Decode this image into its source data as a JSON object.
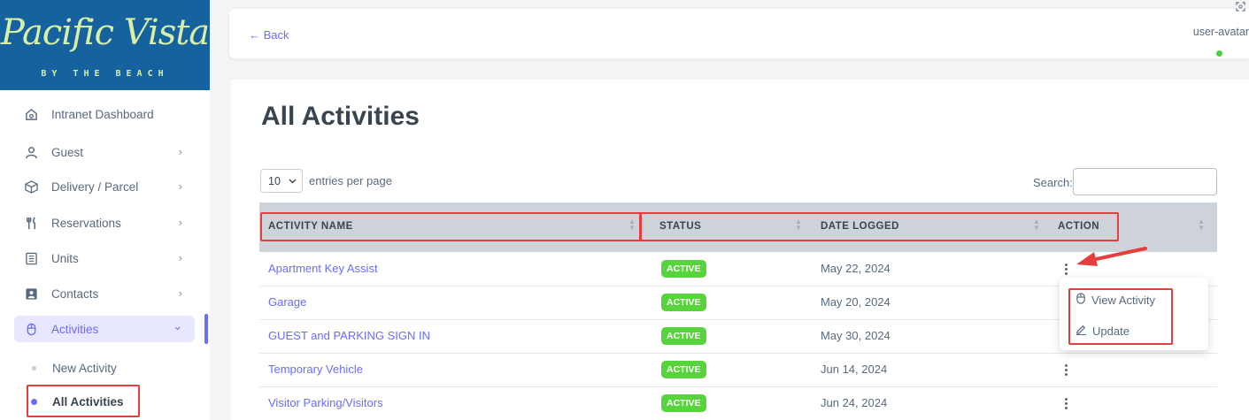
{
  "brand": {
    "name": "Pacific Vista",
    "tagline": "BY THE BEACH"
  },
  "sidebar": {
    "items": [
      {
        "label": "Intranet Dashboard",
        "icon": "home-icon",
        "has_chevron": false
      },
      {
        "label": "Guest",
        "icon": "user-icon",
        "has_chevron": true
      },
      {
        "label": "Delivery / Parcel",
        "icon": "package-icon",
        "has_chevron": true
      },
      {
        "label": "Reservations",
        "icon": "utensils-icon",
        "has_chevron": true
      },
      {
        "label": "Units",
        "icon": "list-icon",
        "has_chevron": true
      },
      {
        "label": "Contacts",
        "icon": "contact-card-icon",
        "has_chevron": true
      },
      {
        "label": "Activities",
        "icon": "mouse-icon",
        "has_chevron": true,
        "expanded": true,
        "active": true
      }
    ],
    "subitems": [
      {
        "label": "New Activity"
      },
      {
        "label": "All Activities",
        "current": true
      }
    ],
    "chevron_right": "›",
    "chevron_down": "⌄"
  },
  "topbar": {
    "back_label": "← Back",
    "avatar_alt": "user-avatar",
    "avatar_status_color": "#4ccf3d"
  },
  "main": {
    "title": "All Activities",
    "entries": {
      "value": "10",
      "label": "entries per page"
    },
    "search": {
      "label": "Search:",
      "value": ""
    },
    "columns": [
      "ACTIVITY NAME",
      "STATUS",
      "DATE LOGGED",
      "ACTION"
    ],
    "rows": [
      {
        "name": "Apartment Key Assist",
        "status": "ACTIVE",
        "date": "May 22, 2024"
      },
      {
        "name": "Garage",
        "status": "ACTIVE",
        "date": "May 20, 2024"
      },
      {
        "name": "GUEST and PARKING SIGN IN",
        "status": "ACTIVE",
        "date": "May 30, 2024"
      },
      {
        "name": "Temporary Vehicle",
        "status": "ACTIVE",
        "date": "Jun 14, 2024"
      },
      {
        "name": "Visitor Parking/Visitors",
        "status": "ACTIVE",
        "date": "Jun 24, 2024"
      }
    ],
    "action_menu": {
      "items": [
        {
          "label": "View Activity",
          "icon": "mouse-icon"
        },
        {
          "label": "Update",
          "icon": "pencil-icon"
        }
      ]
    }
  },
  "colors": {
    "accent": "#696cff",
    "status_active": "#57d43b",
    "highlight": "#e53e3e",
    "brand_bg": "#16629f",
    "brand_text": "#d8efa8"
  }
}
